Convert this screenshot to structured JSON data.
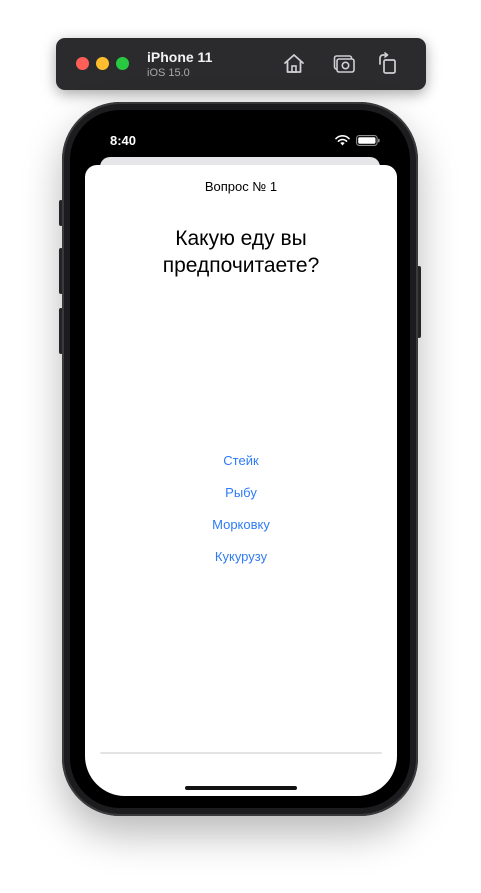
{
  "simulator": {
    "device_name": "iPhone 11",
    "os_version": "iOS 15.0",
    "toolbar_icons": [
      "home-icon",
      "screenshot-icon",
      "rotate-icon"
    ]
  },
  "status_bar": {
    "time": "8:40",
    "icons": [
      "wifi-icon",
      "battery-icon"
    ]
  },
  "quiz": {
    "question_number": "Вопрос № 1",
    "question_text": "Какую еду вы предпочитаете?",
    "answers": [
      "Стейк",
      "Рыбу",
      "Морковку",
      "Кукурузу"
    ],
    "progress_fraction": 0,
    "accent_color": "#2f7bf6"
  }
}
